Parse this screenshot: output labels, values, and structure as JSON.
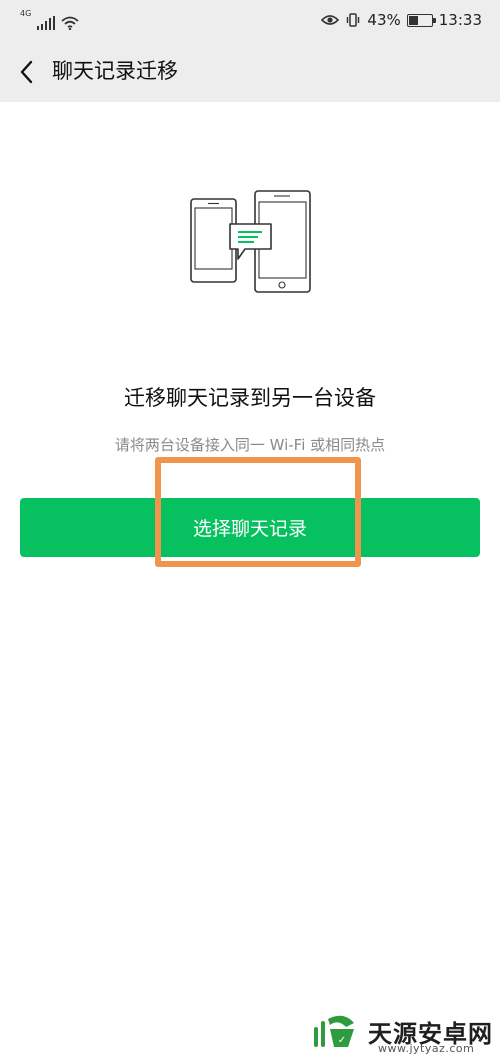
{
  "status_bar": {
    "network_label": "4G",
    "battery_text": "43%",
    "battery_level": 0.43,
    "time": "13:33"
  },
  "header": {
    "title": "聊天记录迁移",
    "back_icon": "chevron-left-icon"
  },
  "main": {
    "illustration_icon": "phones-transfer-icon",
    "headline": "迁移聊天记录到另一台设备",
    "subtext": "请将两台设备接入同一 Wi-Fi 或相同热点",
    "primary_button_label": "选择聊天记录"
  },
  "colors": {
    "brand_green": "#07c160",
    "topbar_bg": "#ededed",
    "highlight": "#f0954d"
  },
  "watermark": {
    "text": "天源安卓网",
    "url": "www.jytyaz.com"
  }
}
